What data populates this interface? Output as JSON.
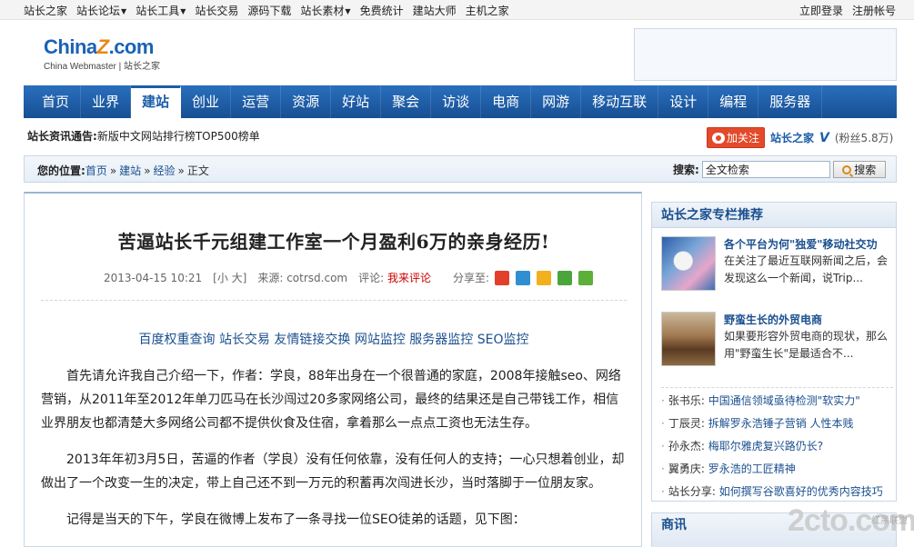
{
  "topbar": {
    "links": [
      {
        "label": "站长之家",
        "dropdown": false
      },
      {
        "label": "站长论坛",
        "dropdown": true
      },
      {
        "label": "站长工具",
        "dropdown": true
      },
      {
        "label": "站长交易",
        "dropdown": false
      },
      {
        "label": "源码下载",
        "dropdown": false
      },
      {
        "label": "站长素材",
        "dropdown": true
      },
      {
        "label": "免费统计",
        "dropdown": false
      },
      {
        "label": "建站大师",
        "dropdown": false
      },
      {
        "label": "主机之家",
        "dropdown": false
      }
    ],
    "login": "立即登录",
    "register": "注册帐号"
  },
  "logo": {
    "brand_part1": "China",
    "brand_z": "Z",
    "brand_part2": ".com",
    "subtitle": "China Webmaster | 站长之家"
  },
  "nav": {
    "items": [
      "首页",
      "业界",
      "建站",
      "创业",
      "运营",
      "资源",
      "好站",
      "聚会",
      "访谈",
      "电商",
      "网游",
      "移动互联",
      "设计",
      "编程",
      "服务器"
    ],
    "active_index": 2
  },
  "notice": {
    "label": "站长资讯通告:",
    "text": "新版中文网站排行榜TOP500榜单"
  },
  "weibo": {
    "follow_label": "加关注",
    "account": "站长之家",
    "verified": "V",
    "fans": "(粉丝5.8万)"
  },
  "breadcrumb": {
    "label": "您的位置:",
    "items": [
      "首页",
      "建站",
      "经验",
      "正文"
    ],
    "separator": "»"
  },
  "search": {
    "label": "搜索:",
    "value": "全文检索",
    "button": "搜索"
  },
  "article": {
    "title": "苦逼站长千元组建工作室一个月盈利6万的亲身经历!",
    "date": "2013-04-15 10:21",
    "size_switch": "[小 大]",
    "source_label": "来源:",
    "source": "cotrsd.com",
    "comment_label": "评论:",
    "comment_link": "我来评论",
    "share_label": "分享至:",
    "share_icons": [
      {
        "name": "sina-weibo-icon",
        "color": "#e2402b"
      },
      {
        "name": "tencent-weibo-icon",
        "color": "#2f8fd0"
      },
      {
        "name": "qzone-icon",
        "color": "#f2b01e"
      },
      {
        "name": "clover-icon",
        "color": "#4aa53c"
      },
      {
        "name": "more-share-icon",
        "color": "#5cb038"
      }
    ],
    "ad_links": [
      "百度权重查询",
      "站长交易",
      "友情链接交换",
      "网站监控",
      "服务器监控",
      "SEO监控"
    ],
    "paragraphs": [
      "首先请允许我自己介绍一下，作者：学良，88年出身在一个很普通的家庭，2008年接触seo、网络营销，从2011年至2012年单刀匹马在长沙闯过20多家网络公司，最终的结果还是自己带钱工作，相信业界朋友也都清楚大多网络公司都不提供伙食及住宿，拿着那么一点点工资也无法生存。",
      "2013年年初3月5日，苦逼的作者（学良）没有任何依靠，没有任何人的支持；一心只想着创业，却做出了一个改变一生的决定，带上自己还不到一万元的积蓄再次闯进长沙，当时落脚于一位朋友家。",
      "记得是当天的下午，学良在微博上发布了一条寻找一位SEO徒弟的话题，见下图："
    ]
  },
  "sidebar": {
    "title": "站长之家专栏推荐",
    "featured": [
      {
        "title": "各个平台为何\"独爱\"移动社交功",
        "desc": "在关注了最近互联网新闻之后，会发现这么一个新闻，说Trip..."
      },
      {
        "title": "野蛮生长的外贸电商",
        "desc": "如果要形容外贸电商的现状，那么用\"野蛮生长\"是最适合不..."
      }
    ],
    "list": [
      {
        "who": "张书乐:",
        "what": "中国通信领域亟待检测\"软实力\""
      },
      {
        "who": "丁辰灵:",
        "what": "拆解罗永浩锤子营销 人性本贱"
      },
      {
        "who": "孙永杰:",
        "what": "梅耶尔雅虎复兴路仍长?"
      },
      {
        "who": "翼勇庆:",
        "what": "罗永浩的工匠精神"
      },
      {
        "who": "站长分享:",
        "what": "如何撰写谷歌喜好的优秀内容技巧"
      }
    ],
    "next_section_title": "商讯"
  },
  "watermark": {
    "big": "2cto.com",
    "small": "红黑联盟"
  }
}
